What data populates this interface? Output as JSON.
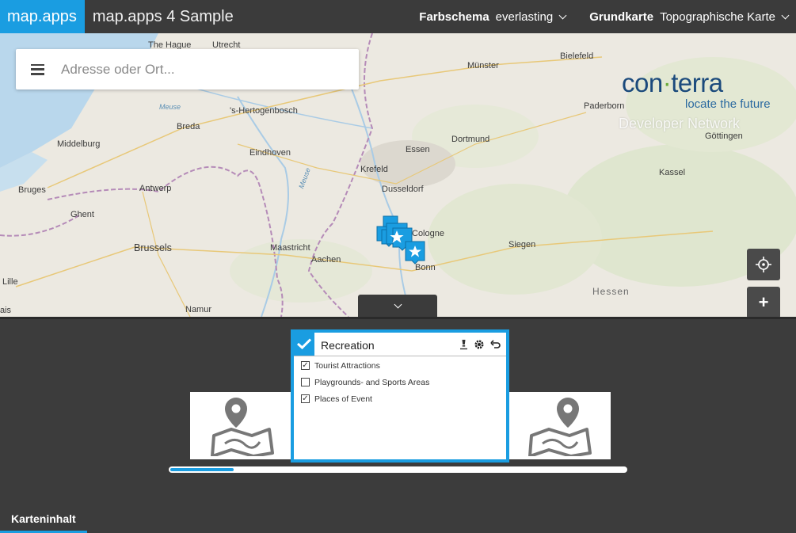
{
  "header": {
    "brand": "map.apps",
    "title": "map.apps 4 Sample",
    "colorscheme_label": "Farbschema",
    "colorscheme_value": "everlasting",
    "basemap_label": "Grundkarte",
    "basemap_value": "Topographische Karte"
  },
  "search": {
    "placeholder": "Adresse oder Ort..."
  },
  "logo": {
    "word_left": "con",
    "word_right": "terra",
    "tagline": "locate the future",
    "network": "Developer Network"
  },
  "map": {
    "cities": [
      {
        "name": "The Hague"
      },
      {
        "name": "Utrecht"
      },
      {
        "name": "'s-Hertogenbosch"
      },
      {
        "name": "Breda"
      },
      {
        "name": "Middelburg"
      },
      {
        "name": "Eindhoven"
      },
      {
        "name": "Antwerp"
      },
      {
        "name": "Bruges"
      },
      {
        "name": "Ghent"
      },
      {
        "name": "Brussels"
      },
      {
        "name": "Lille"
      },
      {
        "name": "Namur"
      },
      {
        "name": "Maastricht"
      },
      {
        "name": "Aachen"
      },
      {
        "name": "Krefeld"
      },
      {
        "name": "Essen"
      },
      {
        "name": "Dusseldorf"
      },
      {
        "name": "Dortmund"
      },
      {
        "name": "Münster"
      },
      {
        "name": "Bielefeld"
      },
      {
        "name": "Paderborn"
      },
      {
        "name": "Göttingen"
      },
      {
        "name": "Kassel"
      },
      {
        "name": "Siegen"
      },
      {
        "name": "Bonn"
      },
      {
        "name": "Cologne"
      }
    ],
    "water_labels": [
      "Meuse",
      "Meuse"
    ],
    "region_label": "Hessen",
    "edge_fragment": "ais"
  },
  "map_controls": {
    "locate_icon": "crosshair-icon",
    "zoom_in": "+"
  },
  "panel": {
    "card": {
      "title": "Recreation",
      "layers": [
        {
          "label": "Tourist Attractions",
          "checked": true
        },
        {
          "label": "Playgrounds- and Sports Areas",
          "checked": false
        },
        {
          "label": "Places of Event",
          "checked": true
        }
      ]
    },
    "tab": "Karteninhalt"
  },
  "colors": {
    "accent": "#1a9de1",
    "bar": "#3b3b3b",
    "panel": "#3c3c3c"
  }
}
